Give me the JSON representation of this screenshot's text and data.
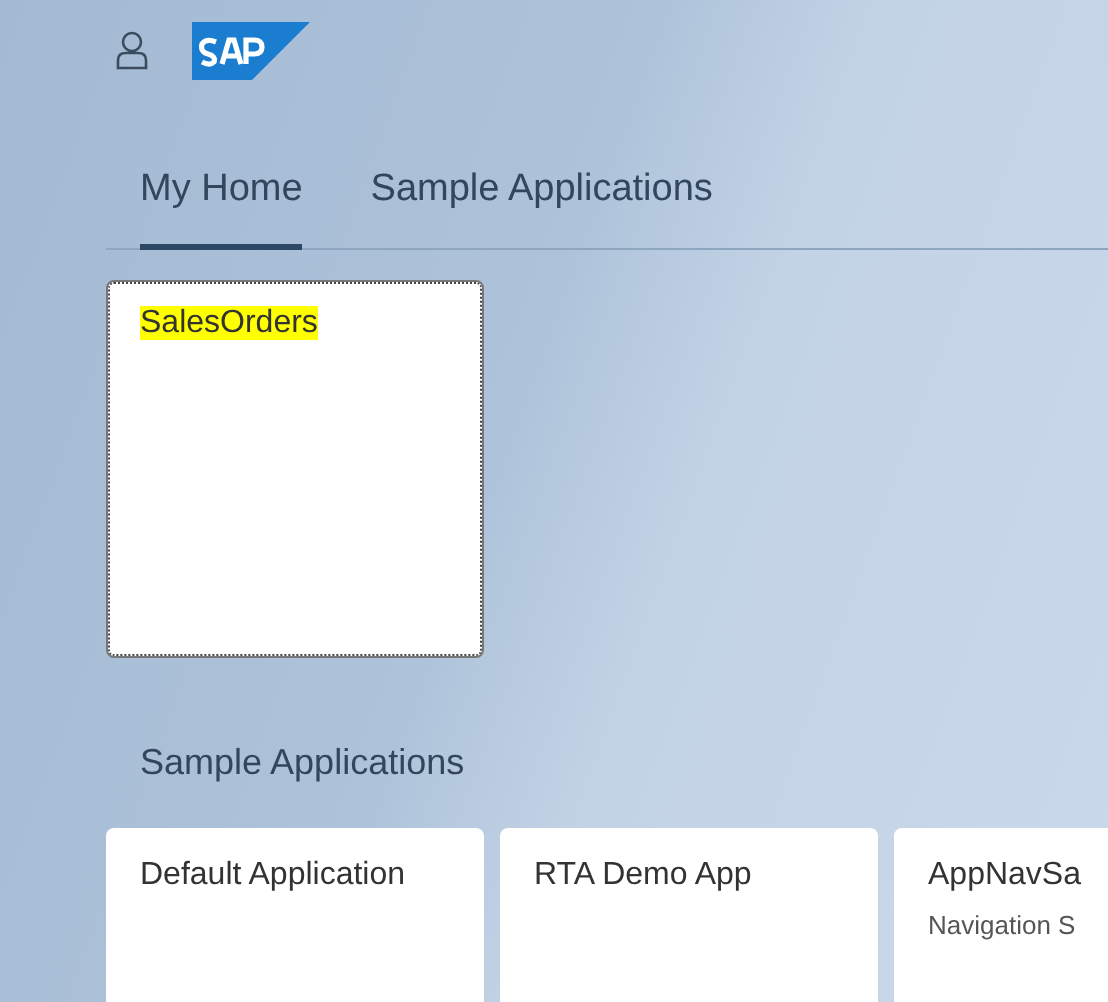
{
  "tabs": [
    {
      "label": "My Home",
      "selected": true
    },
    {
      "label": "Sample Applications",
      "selected": false
    }
  ],
  "home_tiles": [
    {
      "title": "SalesOrders",
      "highlighted": true,
      "focused": true
    }
  ],
  "group": {
    "title": "Sample Applications",
    "tiles": [
      {
        "title": "Default Application"
      },
      {
        "title": "RTA Demo App"
      },
      {
        "title": "AppNavSa",
        "subtitle": "Navigation S"
      }
    ]
  }
}
